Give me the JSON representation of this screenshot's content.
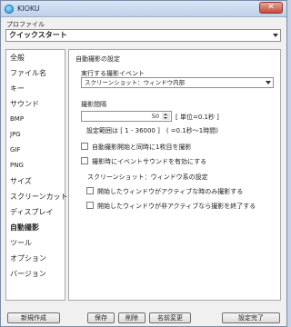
{
  "window": {
    "title": "KIOKU",
    "close_glyph": "✕"
  },
  "profile": {
    "label": "プロファイル",
    "selected": "クイックスタート"
  },
  "sidebar": {
    "items": [
      {
        "label": "全般"
      },
      {
        "label": "ファイル名"
      },
      {
        "label": "キー"
      },
      {
        "label": "サウンド"
      },
      {
        "label": "BMP"
      },
      {
        "label": "JPG"
      },
      {
        "label": "GIF"
      },
      {
        "label": "PNG"
      },
      {
        "label": "サイズ"
      },
      {
        "label": "スクリーンカット"
      },
      {
        "label": "ディスプレイ"
      },
      {
        "label": "自動撮影"
      },
      {
        "label": "ツール"
      },
      {
        "label": "オプション"
      },
      {
        "label": "バージョン"
      }
    ],
    "active": "自動撮影"
  },
  "panel": {
    "title": "自動撮影の設定",
    "event_label": "実行する撮影イベント",
    "event_value": "スクリーンショット：ウィンドウ内部",
    "interval_label": "撮影間隔",
    "interval_value": "50",
    "interval_unit": "[ 単位=0.1秒 ]",
    "interval_range": "設定範囲は [ 1 - 36000 ]　( =0.1秒～1時間)",
    "chk_first": "自動撮影開始と同時に1枚目を撮影",
    "chk_sound": "撮影時にイベントサウンドを有効にする",
    "window_section": "スクリーンショット：ウィンドウ系の設定",
    "chk_active_only": "開始したウィンドウがアクティブな時のみ撮影する",
    "chk_inactive_stop": "開始したウィンドウが非アクティブなら撮影を終了する"
  },
  "buttons": {
    "new": "新規作成",
    "save": "保存",
    "delete": "削除",
    "rename": "名前変更",
    "done": "設定完了"
  }
}
